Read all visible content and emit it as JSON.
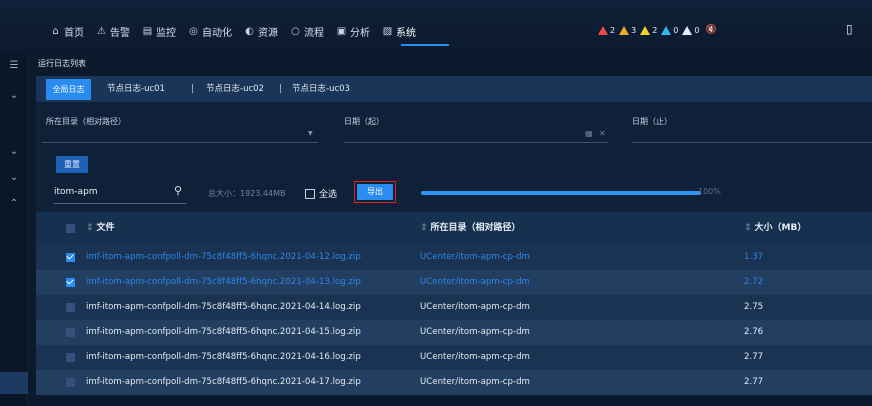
{
  "nav": {
    "items": [
      {
        "icon": "⌂",
        "label": "首页",
        "name": "home"
      },
      {
        "icon": "⚠",
        "label": "告警",
        "name": "alarm"
      },
      {
        "icon": "▤",
        "label": "监控",
        "name": "monitor"
      },
      {
        "icon": "◎",
        "label": "自动化",
        "name": "automation"
      },
      {
        "icon": "◐",
        "label": "资源",
        "name": "resource"
      },
      {
        "icon": "○",
        "label": "流程",
        "name": "process"
      },
      {
        "icon": "▣",
        "label": "分析",
        "name": "analysis"
      },
      {
        "icon": "▧",
        "label": "系统",
        "name": "system"
      }
    ],
    "alerts": [
      {
        "count": "2",
        "color": "#f04848"
      },
      {
        "count": "3",
        "color": "#f5a623"
      },
      {
        "count": "2",
        "color": "#f2d12c"
      },
      {
        "count": "0",
        "color": "#2fb8e8"
      },
      {
        "count": "0",
        "color": "#e8edf5"
      }
    ]
  },
  "breadcrumb": "运行日志列表",
  "tabs": {
    "active": "全局日志",
    "items": [
      "节点日志-uc01",
      "节点日志-uc02",
      "节点日志-uc03"
    ],
    "separator": "|"
  },
  "filters": {
    "dir_label": "所在目录（相对路径）",
    "date_from_label": "日期（起）",
    "date_to_label": "日期（止）",
    "reset_label": "重置"
  },
  "toolbar": {
    "search_value": "itom-apm",
    "total_size": "总大小：1923.44MB",
    "select_all_label": "全选",
    "export_label": "导出",
    "progress_percent": 100,
    "progress_text": "100%"
  },
  "table": {
    "columns": [
      "文件",
      "所在目录（相对路径）",
      "大小（MB）"
    ],
    "rows": [
      {
        "file": "imf-itom-apm-confpoll-dm-75c8f48ff5-6hqnc.2021-04-12.log.zip",
        "dir": "UCenter/itom-apm-cp-dm",
        "size": "1.37",
        "checked": true
      },
      {
        "file": "imf-itom-apm-confpoll-dm-75c8f48ff5-6hqnc.2021-04-13.log.zip",
        "dir": "UCenter/itom-apm-cp-dm",
        "size": "2.72",
        "checked": true
      },
      {
        "file": "imf-itom-apm-confpoll-dm-75c8f48ff5-6hqnc.2021-04-14.log.zip",
        "dir": "UCenter/itom-apm-cp-dm",
        "size": "2.75",
        "checked": false
      },
      {
        "file": "imf-itom-apm-confpoll-dm-75c8f48ff5-6hqnc.2021-04-15.log.zip",
        "dir": "UCenter/itom-apm-cp-dm",
        "size": "2.76",
        "checked": false
      },
      {
        "file": "imf-itom-apm-confpoll-dm-75c8f48ff5-6hqnc.2021-04-16.log.zip",
        "dir": "UCenter/itom-apm-cp-dm",
        "size": "2.77",
        "checked": false
      },
      {
        "file": "imf-itom-apm-confpoll-dm-75c8f48ff5-6hqnc.2021-04-17.log.zip",
        "dir": "UCenter/itom-apm-cp-dm",
        "size": "2.77",
        "checked": false
      }
    ]
  }
}
